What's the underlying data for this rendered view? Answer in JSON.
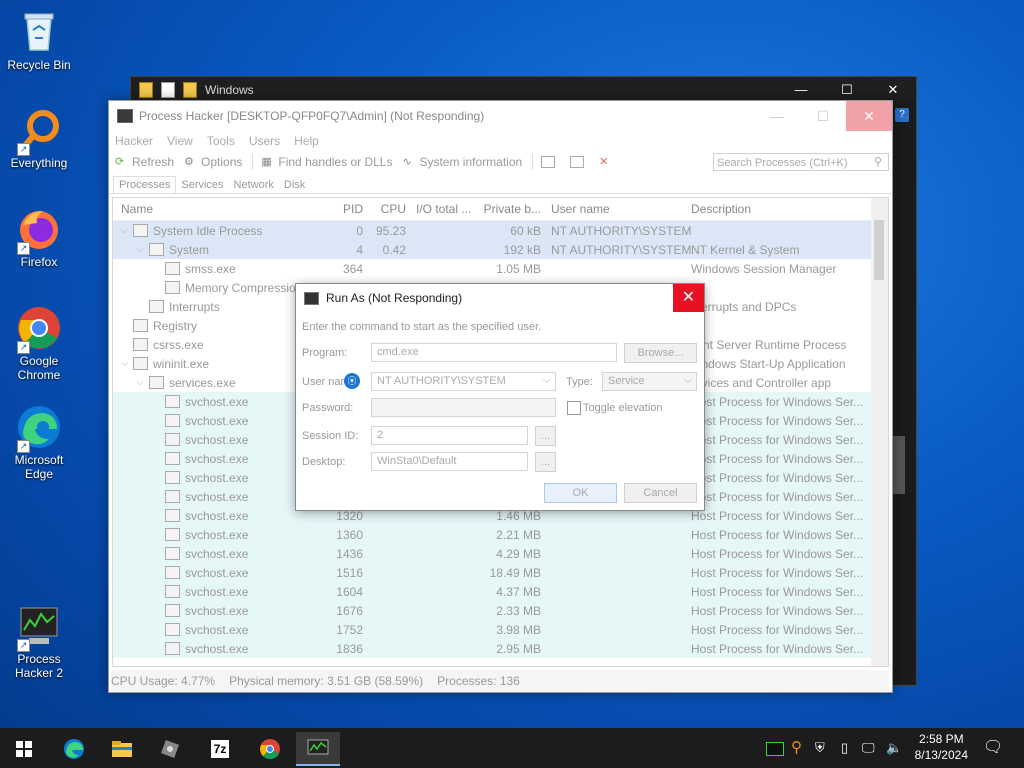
{
  "desktop": {
    "icons": [
      {
        "label": "Recycle Bin",
        "icon": "recycle-bin-icon"
      },
      {
        "label": "Everything",
        "icon": "search-magnifier-icon"
      },
      {
        "label": "Firefox",
        "icon": "firefox-icon"
      },
      {
        "label": "Google Chrome",
        "icon": "chrome-icon"
      },
      {
        "label": "Microsoft Edge",
        "icon": "edge-icon"
      },
      {
        "label": "Process Hacker 2",
        "icon": "process-hacker-icon"
      }
    ]
  },
  "explorer": {
    "title": "Windows"
  },
  "ph": {
    "title": "Process Hacker [DESKTOP-QFP0FQ7\\Admin] (Not Responding)",
    "menu": [
      "Hacker",
      "View",
      "Tools",
      "Users",
      "Help"
    ],
    "toolbar": {
      "refresh": "Refresh",
      "options": "Options",
      "find_handles": "Find handles or DLLs",
      "system_info": "System information"
    },
    "search_placeholder": "Search Processes (Ctrl+K)",
    "tabs": [
      "Processes",
      "Services",
      "Network",
      "Disk"
    ],
    "columns": [
      "Name",
      "PID",
      "CPU",
      "I/O total ...",
      "Private b...",
      "User name",
      "Description"
    ],
    "rows": [
      {
        "indent": 0,
        "arrow": "⌵",
        "name": "System Idle Process",
        "pid": "0",
        "cpu": "95.23",
        "io": "",
        "priv": "60 kB",
        "user": "NT AUTHORITY\\SYSTEM",
        "desc": "",
        "style": "sys"
      },
      {
        "indent": 1,
        "arrow": "⌵",
        "name": "System",
        "pid": "4",
        "cpu": "0.42",
        "io": "",
        "priv": "192 kB",
        "user": "NT AUTHORITY\\SYSTEM",
        "desc": "NT Kernel & System",
        "style": "sys"
      },
      {
        "indent": 2,
        "arrow": "",
        "name": "smss.exe",
        "pid": "364",
        "cpu": "",
        "io": "",
        "priv": "1.05 MB",
        "user": "",
        "desc": "Windows Session Manager",
        "style": ""
      },
      {
        "indent": 2,
        "arrow": "",
        "name": "Memory Compressio...",
        "pid": "",
        "cpu": "",
        "io": "",
        "priv": "",
        "user": "",
        "desc": "",
        "style": ""
      },
      {
        "indent": 1,
        "arrow": "",
        "name": "Interrupts",
        "pid": "",
        "cpu": "",
        "io": "",
        "priv": "",
        "user": "",
        "desc": "nterrupts and DPCs",
        "style": ""
      },
      {
        "indent": 0,
        "arrow": "",
        "name": "Registry",
        "pid": "",
        "cpu": "",
        "io": "",
        "priv": "",
        "user": "",
        "desc": "",
        "style": ""
      },
      {
        "indent": 0,
        "arrow": "",
        "name": "csrss.exe",
        "pid": "",
        "cpu": "",
        "io": "",
        "priv": "",
        "user": "",
        "desc": "lient Server Runtime Process",
        "style": ""
      },
      {
        "indent": 0,
        "arrow": "⌵",
        "name": "wininit.exe",
        "pid": "",
        "cpu": "",
        "io": "",
        "priv": "",
        "user": "",
        "desc": "Vindows Start-Up Application",
        "style": ""
      },
      {
        "indent": 1,
        "arrow": "⌵",
        "name": "services.exe",
        "pid": "",
        "cpu": "",
        "io": "",
        "priv": "",
        "user": "",
        "desc": "ervices and Controller app",
        "style": ""
      },
      {
        "indent": 2,
        "arrow": "",
        "name": "svchost.exe",
        "pid": "",
        "cpu": "",
        "io": "",
        "priv": "",
        "user": "",
        "desc": "Host Process for Windows Ser...",
        "style": "svc"
      },
      {
        "indent": 2,
        "arrow": "",
        "name": "svchost.exe",
        "pid": "",
        "cpu": "",
        "io": "",
        "priv": "",
        "user": "",
        "desc": "Host Process for Windows Ser...",
        "style": "svc"
      },
      {
        "indent": 2,
        "arrow": "",
        "name": "svchost.exe",
        "pid": "",
        "cpu": "",
        "io": "",
        "priv": "",
        "user": "",
        "desc": "Host Process for Windows Ser...",
        "style": "svc"
      },
      {
        "indent": 2,
        "arrow": "",
        "name": "svchost.exe",
        "pid": "",
        "cpu": "",
        "io": "",
        "priv": "",
        "user": "",
        "desc": "Host Process for Windows Ser...",
        "style": "svc"
      },
      {
        "indent": 2,
        "arrow": "",
        "name": "svchost.exe",
        "pid": "",
        "cpu": "",
        "io": "",
        "priv": "",
        "user": "",
        "desc": "Host Process for Windows Ser...",
        "style": "svc"
      },
      {
        "indent": 2,
        "arrow": "",
        "name": "svchost.exe",
        "pid": "",
        "cpu": "",
        "io": "",
        "priv": "",
        "user": "",
        "desc": "Host Process for Windows Ser...",
        "style": "svc"
      },
      {
        "indent": 2,
        "arrow": "",
        "name": "svchost.exe",
        "pid": "1320",
        "cpu": "",
        "io": "",
        "priv": "1.46 MB",
        "user": "",
        "desc": "Host Process for Windows Ser...",
        "style": "svc"
      },
      {
        "indent": 2,
        "arrow": "",
        "name": "svchost.exe",
        "pid": "1360",
        "cpu": "",
        "io": "",
        "priv": "2.21 MB",
        "user": "",
        "desc": "Host Process for Windows Ser...",
        "style": "svc"
      },
      {
        "indent": 2,
        "arrow": "",
        "name": "svchost.exe",
        "pid": "1436",
        "cpu": "",
        "io": "",
        "priv": "4.29 MB",
        "user": "",
        "desc": "Host Process for Windows Ser...",
        "style": "svc"
      },
      {
        "indent": 2,
        "arrow": "",
        "name": "svchost.exe",
        "pid": "1516",
        "cpu": "",
        "io": "",
        "priv": "18.49 MB",
        "user": "",
        "desc": "Host Process for Windows Ser...",
        "style": "svc"
      },
      {
        "indent": 2,
        "arrow": "",
        "name": "svchost.exe",
        "pid": "1604",
        "cpu": "",
        "io": "",
        "priv": "4.37 MB",
        "user": "",
        "desc": "Host Process for Windows Ser...",
        "style": "svc"
      },
      {
        "indent": 2,
        "arrow": "",
        "name": "svchost.exe",
        "pid": "1676",
        "cpu": "",
        "io": "",
        "priv": "2.33 MB",
        "user": "",
        "desc": "Host Process for Windows Ser...",
        "style": "svc"
      },
      {
        "indent": 2,
        "arrow": "",
        "name": "svchost.exe",
        "pid": "1752",
        "cpu": "",
        "io": "",
        "priv": "3.98 MB",
        "user": "",
        "desc": "Host Process for Windows Ser...",
        "style": "svc"
      },
      {
        "indent": 2,
        "arrow": "",
        "name": "svchost.exe",
        "pid": "1836",
        "cpu": "",
        "io": "",
        "priv": "2.95 MB",
        "user": "",
        "desc": "Host Process for Windows Ser...",
        "style": "svc"
      }
    ],
    "status": {
      "cpu": "CPU Usage: 4.77%",
      "mem": "Physical memory: 3.51 GB (58.59%)",
      "procs": "Processes: 136"
    }
  },
  "dialog": {
    "title": "Run As (Not Responding)",
    "instruction": "Enter the command to start as the specified user.",
    "program_label": "Program:",
    "program_value": "cmd.exe",
    "browse": "Browse...",
    "username_label": "User nar",
    "username_value": "NT AUTHORITY\\SYSTEM",
    "type_label": "Type:",
    "type_value": "Service",
    "password_label": "Password:",
    "toggle_elevation": "Toggle elevation",
    "session_label": "Session ID:",
    "session_value": "2",
    "desktop_label": "Desktop:",
    "desktop_value": "WinSta0\\Default",
    "ellipsis": "...",
    "ok": "OK",
    "cancel": "Cancel"
  },
  "taskbar": {
    "time": "2:58 PM",
    "date": "8/13/2024",
    "apps": [
      "windows-start-icon",
      "edge-icon",
      "file-explorer-icon",
      "tools-icon",
      "7zip-icon",
      "chrome-icon",
      "process-hacker-icon"
    ],
    "seven_zip": "7z"
  }
}
